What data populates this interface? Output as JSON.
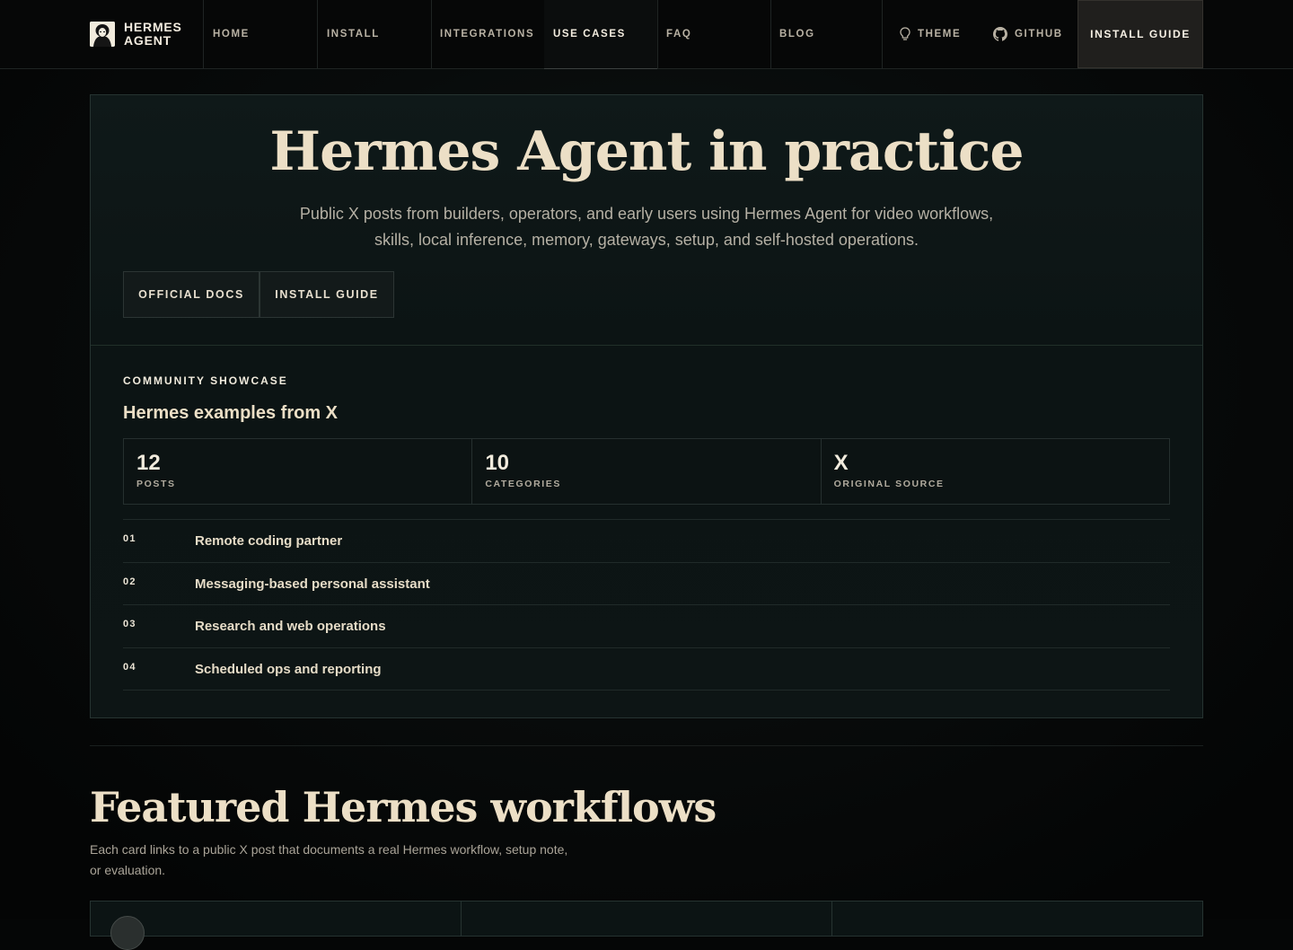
{
  "nav": {
    "brand_line1": "HERMES",
    "brand_line2": "AGENT",
    "items": [
      {
        "label": "HOME"
      },
      {
        "label": "INSTALL"
      },
      {
        "label": "INTEGRATIONS"
      },
      {
        "label": "USE CASES",
        "active": true
      },
      {
        "label": "FAQ"
      },
      {
        "label": "BLOG"
      }
    ],
    "theme_label": "THEME",
    "theme_icon": "lightbulb-icon",
    "github_label": "GITHUB",
    "github_icon": "github-icon",
    "cta_label": "INSTALL GUIDE"
  },
  "hero": {
    "title": "Hermes Agent in practice",
    "subtitle": "Public X posts from builders, operators, and early users using Hermes Agent for video workflows, skills, local inference, memory, gateways, setup, and self-hosted operations.",
    "buttons": [
      "OFFICIAL DOCS",
      "INSTALL GUIDE"
    ]
  },
  "showcase": {
    "eyebrow": "COMMUNITY SHOWCASE",
    "title": "Hermes examples from X",
    "stats": [
      {
        "value": "12",
        "label": "POSTS"
      },
      {
        "value": "10",
        "label": "CATEGORIES"
      },
      {
        "value": "X",
        "label": "ORIGINAL SOURCE"
      }
    ],
    "list": [
      {
        "num": "01",
        "label": "Remote coding partner"
      },
      {
        "num": "02",
        "label": "Messaging-based personal assistant"
      },
      {
        "num": "03",
        "label": "Research and web operations"
      },
      {
        "num": "04",
        "label": "Scheduled ops and reporting"
      }
    ]
  },
  "featured": {
    "title": "Featured Hermes workflows",
    "subtitle": "Each card links to a public X post that documents a real Hermes workflow, setup note, or evaluation."
  },
  "colors": {
    "background": "#050606",
    "panel": "#0f1919",
    "accent_text": "#ecdfc6"
  }
}
